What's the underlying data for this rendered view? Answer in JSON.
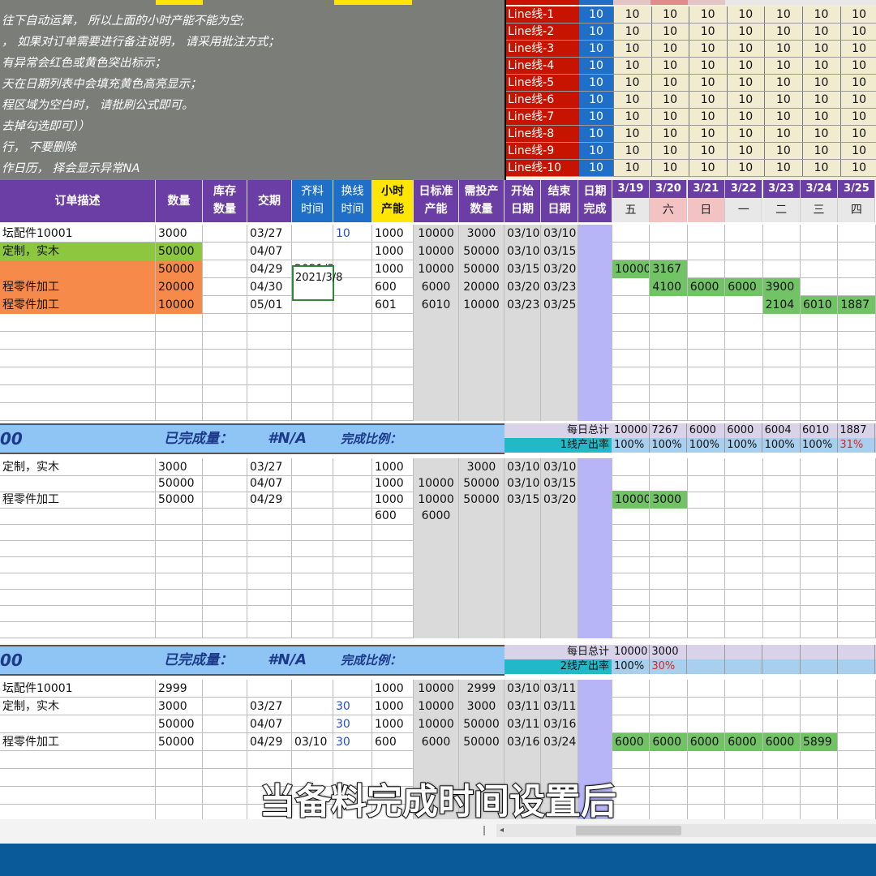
{
  "notes": [
    "往下自动运算， 所以上面的小时产能不能为空;",
    "， 如果对订单需要进行备注说明， 请采用批注方式；",
    "有异常会红色或黄色突出标示；",
    "天在日期列表中会填充黄色高亮显示；",
    "程区域为空白时， 请批刷公式即可。",
    "去掉勾选即可））",
    "行， 不要删除",
    "作日历， 择会显示异常NA"
  ],
  "lines": [
    {
      "label": "Line线-1",
      "val": "10"
    },
    {
      "label": "Line线-2",
      "val": "10"
    },
    {
      "label": "Line线-3",
      "val": "10"
    },
    {
      "label": "Line线-4",
      "val": "10"
    },
    {
      "label": "Line线-5",
      "val": "10"
    },
    {
      "label": "Line线-6",
      "val": "10"
    },
    {
      "label": "Line线-7",
      "val": "10"
    },
    {
      "label": "Line线-8",
      "val": "10"
    },
    {
      "label": "Line线-9",
      "val": "10"
    },
    {
      "label": "Line线-10",
      "val": "10"
    }
  ],
  "cap_value": "10",
  "headers": {
    "order_desc": "订单描述",
    "qty": "数量",
    "stock_1": "库存",
    "stock_2": "数量",
    "due": "交期",
    "mat_1": "齐料",
    "mat_2": "时间",
    "chg_1": "换线",
    "chg_2": "时间",
    "hour_1": "小时",
    "hour_2": "产能",
    "daystd_1": "日标准",
    "daystd_2": "产能",
    "need_1": "需投产",
    "need_2": "数量",
    "start_1": "开始",
    "start_2": "日期",
    "end_1": "结束",
    "end_2": "日期",
    "done_1": "日期",
    "done_2": "完成"
  },
  "dates": [
    "3/19",
    "3/20",
    "3/21",
    "3/22",
    "3/23",
    "3/24",
    "3/25"
  ],
  "weekdays": [
    "五",
    "六",
    "日",
    "一",
    "二",
    "三",
    "四"
  ],
  "block1": [
    {
      "desc": "坛配件10001",
      "qty": "3000",
      "due": "03/27",
      "mat": "",
      "chg": "10",
      "hour": "1000",
      "std": "10000",
      "need": "3000",
      "start": "03/10",
      "end": "03/10",
      "cal": [
        "",
        "",
        "",
        "",
        "",
        "",
        ""
      ]
    },
    {
      "desc": "定制，实木",
      "qty": "50000",
      "due": "04/07",
      "mat": "",
      "chg": "",
      "hour": "1000",
      "std": "10000",
      "need": "50000",
      "start": "03/10",
      "end": "03/15",
      "cal": [
        "",
        "",
        "",
        "",
        "",
        "",
        ""
      ]
    },
    {
      "desc": "",
      "qty": "50000",
      "due": "04/29",
      "mat": "2021/3/8",
      "chg": "",
      "hour": "1000",
      "std": "10000",
      "need": "50000",
      "start": "03/15",
      "end": "03/20",
      "cal": [
        "10000",
        "3167",
        "",
        "",
        "",
        "",
        ""
      ]
    },
    {
      "desc": "程零件加工",
      "qty": "20000",
      "due": "04/30",
      "mat": "",
      "chg": "",
      "hour": "600",
      "std": "6000",
      "need": "20000",
      "start": "03/20",
      "end": "03/23",
      "cal": [
        "",
        "4100",
        "6000",
        "6000",
        "3900",
        "",
        ""
      ]
    },
    {
      "desc": "程零件加工",
      "qty": "10000",
      "due": "05/01",
      "mat": "",
      "chg": "",
      "hour": "601",
      "std": "6010",
      "need": "10000",
      "start": "03/23",
      "end": "03/25",
      "cal": [
        "",
        "",
        "",
        "",
        "2104",
        "6010",
        "1887"
      ]
    }
  ],
  "summary1": {
    "left": "00",
    "done_label": "已完成量：",
    "na": "#N/A",
    "ratio_label": "完成比例：",
    "daily_label": "每日总计",
    "daily": [
      "10000",
      "7267",
      "6000",
      "6000",
      "6004",
      "6010",
      "1887"
    ],
    "rate_label": "1线产出率",
    "rate": [
      "100%",
      "100%",
      "100%",
      "100%",
      "100%",
      "100%",
      "31%"
    ]
  },
  "block2": [
    {
      "desc": "定制，实木",
      "qty": "3000",
      "due": "03/27",
      "hour": "1000",
      "std": "",
      "need": "3000",
      "start": "03/10",
      "end": "03/10",
      "cal": [
        "",
        "",
        "",
        "",
        "",
        "",
        ""
      ]
    },
    {
      "desc": "",
      "qty": "50000",
      "due": "04/07",
      "hour": "1000",
      "std": "10000",
      "need": "50000",
      "start": "03/10",
      "end": "03/15",
      "cal": [
        "",
        "",
        "",
        "",
        "",
        "",
        ""
      ]
    },
    {
      "desc": "程零件加工",
      "qty": "50000",
      "due": "04/29",
      "hour": "1000",
      "std": "10000",
      "need": "50000",
      "start": "03/15",
      "end": "03/20",
      "cal": [
        "10000",
        "3000",
        "",
        "",
        "",
        "",
        ""
      ]
    },
    {
      "desc": "",
      "qty": "",
      "due": "",
      "hour": "600",
      "std": "6000",
      "need": "",
      "start": "",
      "end": "",
      "cal": [
        "",
        "",
        "",
        "",
        "",
        "",
        ""
      ]
    }
  ],
  "summary2": {
    "left": "00",
    "done_label": "已完成量：",
    "na": "#N/A",
    "ratio_label": "完成比例：",
    "daily_label": "每日总计",
    "daily": [
      "10000",
      "3000"
    ],
    "rate_label": "2线产出率",
    "rate": [
      "100%",
      "30%"
    ]
  },
  "block3": [
    {
      "desc": "坛配件10001",
      "qty": "2999",
      "due": "",
      "mat": "",
      "chg": "",
      "hour": "1000",
      "std": "10000",
      "need": "2999",
      "start": "03/10",
      "end": "03/11",
      "cal": [
        "",
        "",
        "",
        "",
        "",
        "",
        ""
      ]
    },
    {
      "desc": "定制，实木",
      "qty": "3000",
      "due": "03/27",
      "mat": "",
      "chg": "30",
      "hour": "1000",
      "std": "10000",
      "need": "3000",
      "start": "03/11",
      "end": "03/11",
      "cal": [
        "",
        "",
        "",
        "",
        "",
        "",
        ""
      ]
    },
    {
      "desc": "",
      "qty": "50000",
      "due": "04/07",
      "mat": "",
      "chg": "30",
      "hour": "1000",
      "std": "10000",
      "need": "50000",
      "start": "03/11",
      "end": "03/16",
      "cal": [
        "",
        "",
        "",
        "",
        "",
        "",
        ""
      ]
    },
    {
      "desc": "程零件加工",
      "qty": "50000",
      "due": "04/29",
      "mat": "03/10",
      "chg": "30",
      "hour": "600",
      "std": "6000",
      "need": "50000",
      "start": "03/16",
      "end": "03/24",
      "cal": [
        "6000",
        "6000",
        "6000",
        "6000",
        "6000",
        "5899",
        ""
      ]
    }
  ],
  "caption": "当备料完成时间设置后"
}
